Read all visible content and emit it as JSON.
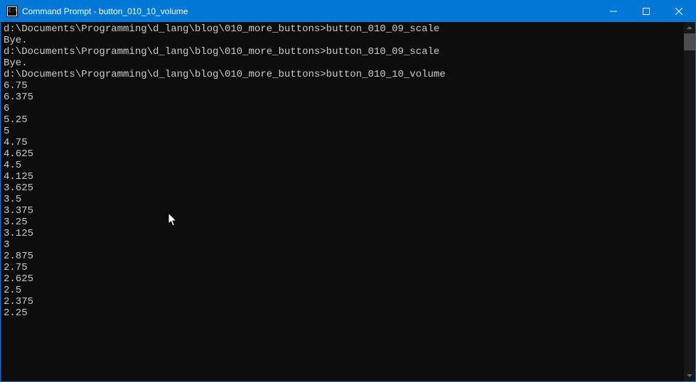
{
  "titlebar": {
    "title": "Command Prompt - button_010_10_volume"
  },
  "terminal": {
    "prompt": "d:\\Documents\\Programming\\d_lang\\blog\\010_more_buttons>",
    "blocks": [
      {
        "command": "button_010_09_scale",
        "output": [
          "Bye."
        ]
      },
      {
        "command": "button_010_09_scale",
        "output": [
          "Bye."
        ]
      },
      {
        "command": "button_010_10_volume",
        "output": [
          "6.75",
          "6.375",
          "6",
          "5.25",
          "5",
          "4.75",
          "4.625",
          "4.5",
          "4.125",
          "3.625",
          "3.5",
          "3.375",
          "3.25",
          "3.125",
          "3",
          "2.875",
          "2.75",
          "2.625",
          "2.5",
          "2.375",
          "2.25"
        ]
      }
    ]
  }
}
